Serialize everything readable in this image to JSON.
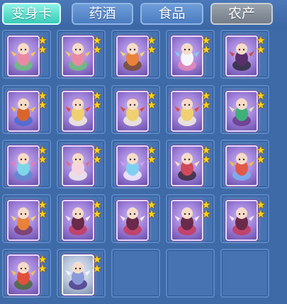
{
  "tabs": [
    {
      "label": "变身卡",
      "state": "active"
    },
    {
      "label": "药酒",
      "state": "normal"
    },
    {
      "label": "食品",
      "state": "normal"
    },
    {
      "label": "农产",
      "state": "dim"
    }
  ],
  "grid": {
    "columns": 5,
    "rows": 5,
    "items": [
      {
        "name": "card-pink-dragon-1",
        "stars": 2,
        "style": "purple",
        "palette": [
          "#e98aa3",
          "#f7c55b",
          "#6bbf7a"
        ]
      },
      {
        "name": "card-pink-dragon-2",
        "stars": 2,
        "style": "purple",
        "palette": [
          "#e98aa3",
          "#f7c55b",
          "#6bbf7a"
        ]
      },
      {
        "name": "card-orange-warrior",
        "stars": 2,
        "style": "purple",
        "palette": [
          "#e8823a",
          "#f2d27a",
          "#7a4a2a"
        ]
      },
      {
        "name": "card-bunny-fairy",
        "stars": 2,
        "style": "purple",
        "palette": [
          "#f5f5ff",
          "#7fd0f0",
          "#e88ab8"
        ]
      },
      {
        "name": "card-dark-rider",
        "stars": 2,
        "style": "purple",
        "palette": [
          "#5a2f6a",
          "#c84a4a",
          "#2a2a3a"
        ]
      },
      {
        "name": "card-fire-warrior",
        "stars": 2,
        "style": "purple",
        "palette": [
          "#d9652a",
          "#f3c14a",
          "#4a6ad0"
        ]
      },
      {
        "name": "card-gold-general-1",
        "stars": 2,
        "style": "purple",
        "palette": [
          "#f0d070",
          "#e04a3a",
          "#f5f0e0"
        ]
      },
      {
        "name": "card-gold-general-2",
        "stars": 2,
        "style": "purple",
        "palette": [
          "#f0d070",
          "#e04a3a",
          "#f5f0e0"
        ]
      },
      {
        "name": "card-gold-general-3",
        "stars": 2,
        "style": "purple",
        "palette": [
          "#f0d070",
          "#e04a3a",
          "#f5f0e0"
        ]
      },
      {
        "name": "card-jade-sage",
        "stars": 2,
        "style": "purple",
        "palette": [
          "#3fb07a",
          "#e8e0c0",
          "#6a3a8a"
        ]
      },
      {
        "name": "card-butterfly-spirit",
        "stars": 2,
        "style": "purple",
        "palette": [
          "#7ed6e8",
          "#f07ab0",
          "#5a8ad0"
        ]
      },
      {
        "name": "card-rabbit-dancer",
        "stars": 2,
        "style": "purple",
        "palette": [
          "#f5d6e0",
          "#e06a8a",
          "#f5f0f0"
        ]
      },
      {
        "name": "card-water-maiden",
        "stars": 2,
        "style": "purple",
        "palette": [
          "#7fcff0",
          "#c8a0f0",
          "#f5f0ff"
        ]
      },
      {
        "name": "card-red-dancer",
        "stars": 2,
        "style": "purple",
        "palette": [
          "#d04a5a",
          "#f5e0c0",
          "#3a2a3a"
        ]
      },
      {
        "name": "card-phoenix-archer",
        "stars": 2,
        "style": "purple",
        "palette": [
          "#e05a4a",
          "#f0c040",
          "#7ab0f0"
        ]
      },
      {
        "name": "card-orange-fighter",
        "stars": 2,
        "style": "purple",
        "palette": [
          "#e8823a",
          "#f2d27a",
          "#7a3a6a"
        ]
      },
      {
        "name": "card-bat-maiden-1",
        "stars": 2,
        "style": "purple",
        "palette": [
          "#6a2a4a",
          "#f5e8ee",
          "#c83a5a"
        ]
      },
      {
        "name": "card-bat-maiden-2",
        "stars": 2,
        "style": "purple",
        "palette": [
          "#6a2a4a",
          "#f5e8ee",
          "#c83a5a"
        ]
      },
      {
        "name": "card-bat-maiden-3",
        "stars": 2,
        "style": "purple",
        "palette": [
          "#6a2a4a",
          "#f5e8ee",
          "#c83a5a"
        ]
      },
      {
        "name": "card-bat-maiden-4",
        "stars": 2,
        "style": "purple",
        "palette": [
          "#6a2a4a",
          "#f5e8ee",
          "#c83a5a"
        ]
      },
      {
        "name": "card-red-monkey",
        "stars": 2,
        "style": "purple",
        "palette": [
          "#e0503a",
          "#f0c060",
          "#4a6a3a"
        ]
      },
      {
        "name": "card-ice-wolf",
        "stars": 2,
        "style": "silver",
        "palette": [
          "#8a9ad8",
          "#f5f5ff",
          "#4a3a8a"
        ]
      },
      {
        "name": "slot-empty",
        "stars": 0,
        "style": "empty",
        "palette": []
      },
      {
        "name": "slot-empty",
        "stars": 0,
        "style": "empty",
        "palette": []
      },
      {
        "name": "slot-empty",
        "stars": 0,
        "style": "empty",
        "palette": []
      }
    ]
  },
  "colors": {
    "background": "#3f6aa8",
    "slot": "#4773b3",
    "active_tab": "#38cbb8",
    "star": "#ffd21a"
  },
  "icons": {
    "star": "star-icon"
  }
}
